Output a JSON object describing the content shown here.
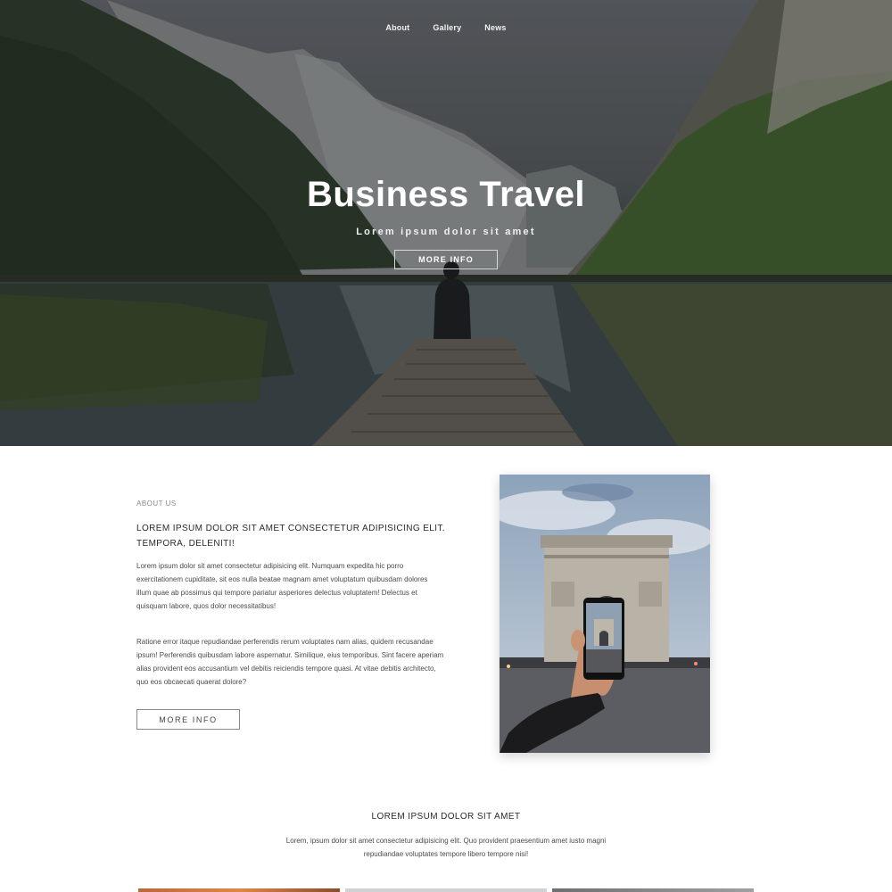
{
  "nav": {
    "items": [
      "About",
      "Gallery",
      "News"
    ]
  },
  "hero": {
    "title": "Business Travel",
    "subtitle": "Lorem ipsum dolor sit amet",
    "button_label": "MORE INFO"
  },
  "about": {
    "label": "ABOUT US",
    "heading": "LOREM IPSUM DOLOR SIT AMET CONSECTETUR ADIPISICING ELIT. TEMPORA, DELENITI!",
    "paragraph1": "Lorem ipsum dolor sit amet consectetur adipisicing elit. Numquam expedita hic porro exercitationem cupiditate, sit eos nulla beatae magnam amet voluptatum quibusdam dolores illum quae ab possimus qui tempore pariatur asperiores delectus voluptatem! Delectus et quisquam labore, quos dolor necessitatibus!",
    "paragraph2": "Ratione error itaque repudiandae perferendis rerum voluptates nam alias, quidem recusandae ipsum! Perferendis quibusdam labore aspernatur. Similique, eius temporibus. Sint facere aperiam alias provident eos accusantium vel debitis reiciendis tempore quasi. At vitae debitis architecto, quo eos obcaecati quaerat dolore?",
    "button_label": "MORE INFO"
  },
  "section2": {
    "title": "LOREM IPSUM DOLOR SIT AMET",
    "text": "Lorem, ipsum dolor sit amet consectetur adipisicing elit. Quo provident praesentium amet iusto magni repudiandae voluptates tempore libero tempore nisi!"
  }
}
